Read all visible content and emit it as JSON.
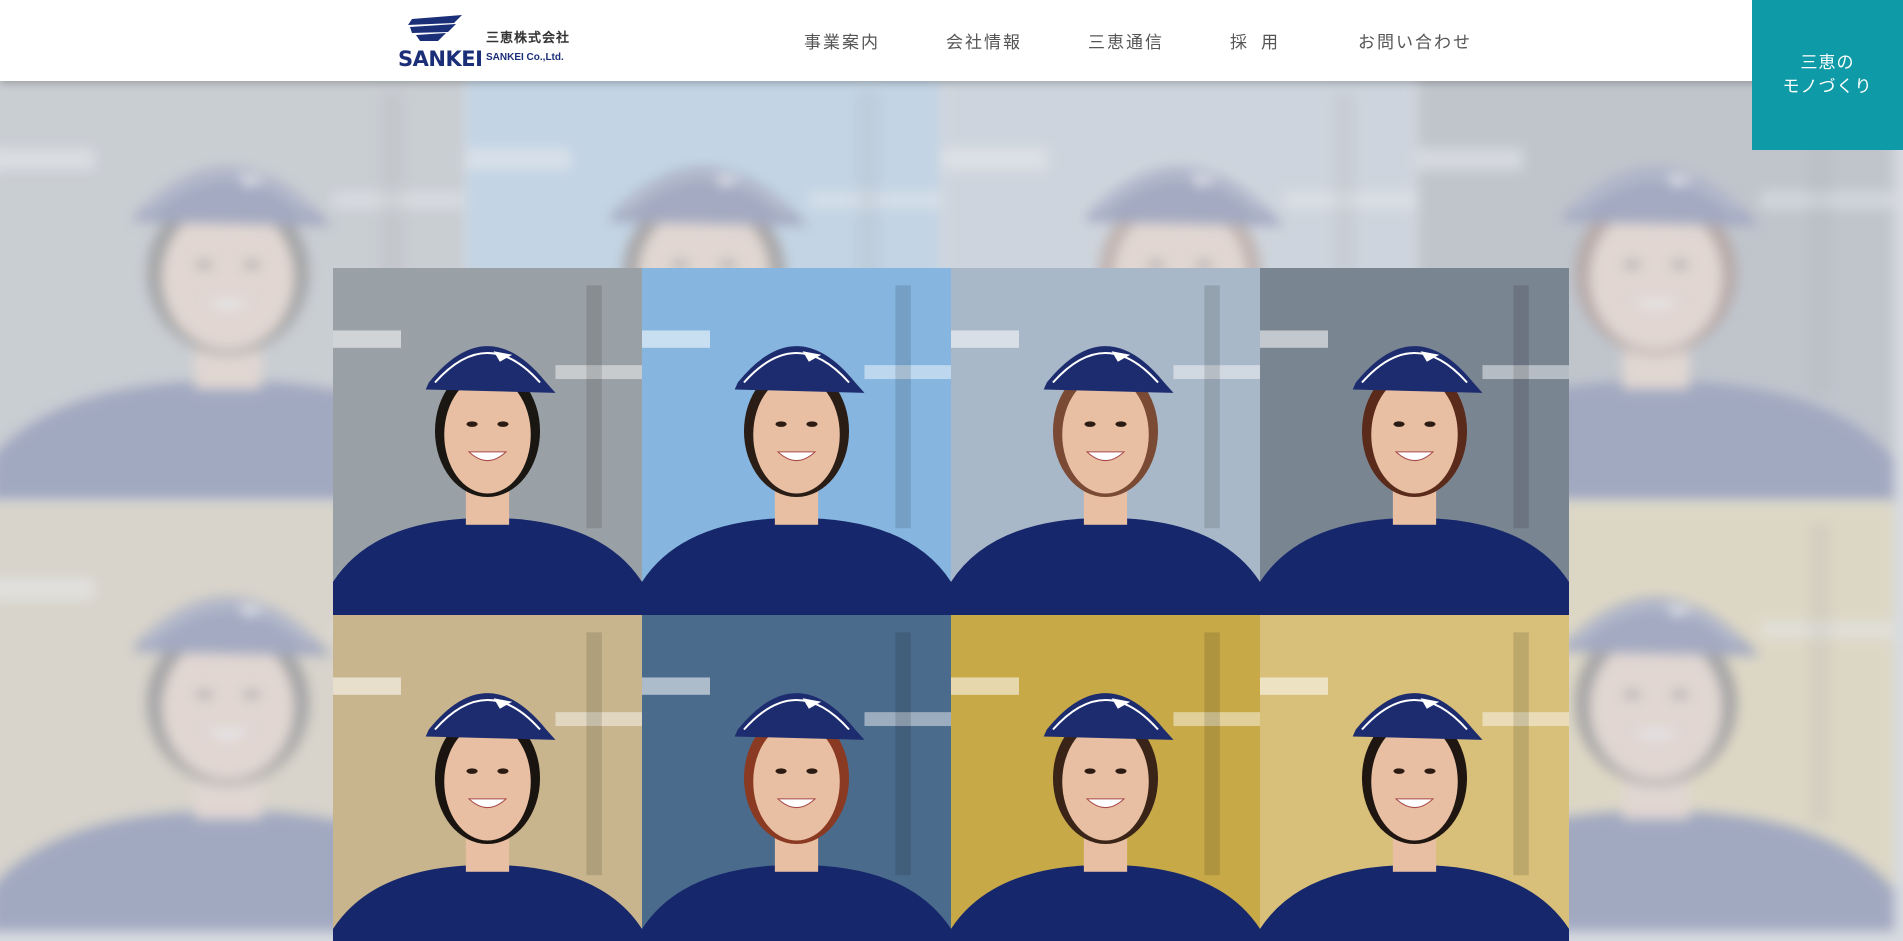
{
  "header": {
    "logo": {
      "wordmark": "SANKEI",
      "name_jp": "三恵株式会社",
      "name_en": "SANKEI Co.,Ltd."
    },
    "nav": [
      {
        "label": "事業案内"
      },
      {
        "label": "会社情報"
      },
      {
        "label": "三恵通信"
      },
      {
        "label": "採用"
      },
      {
        "label": "お問い合わせ"
      }
    ],
    "cta_label": "三恵の\nモノづくり"
  },
  "colors": {
    "brand_navy": "#1b2f78",
    "accent_teal": "#0e9aa6",
    "shirt_navy": "#16286b"
  },
  "hero": {
    "tiles": [
      {
        "person": "man-cap",
        "bg": "#9aa1a6",
        "hair": "#1a1612"
      },
      {
        "person": "woman-glasses",
        "bg": "#86b6e0",
        "hair": "#2a1d15"
      },
      {
        "person": "woman-bob",
        "bg": "#a9b8c8",
        "hair": "#7a4a34"
      },
      {
        "person": "woman-short",
        "bg": "#7a8592",
        "hair": "#5a2a1a"
      },
      {
        "person": "woman-long",
        "bg": "#c9b58d",
        "hair": "#1a1410"
      },
      {
        "person": "woman-redhair",
        "bg": "#4b6b8c",
        "hair": "#8a3a22"
      },
      {
        "person": "man-jacket",
        "bg": "#c8a948",
        "hair": "#3a2418"
      },
      {
        "person": "woman-earrings",
        "bg": "#d8c07a",
        "hair": "#1f1611"
      }
    ]
  }
}
